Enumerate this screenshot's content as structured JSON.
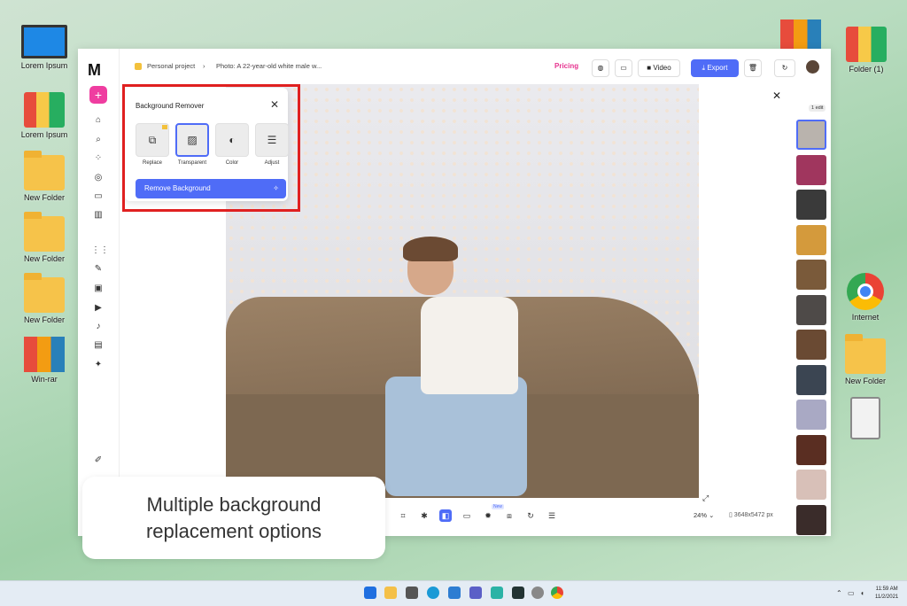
{
  "desktop": {
    "left_icons": [
      {
        "label": "Lorem Ipsum",
        "icon": "computer-icon"
      },
      {
        "label": "Lorem Ipsum",
        "icon": "binders-icon"
      },
      {
        "label": "New Folder",
        "icon": "folder-icon"
      },
      {
        "label": "New Folder",
        "icon": "folder-icon"
      },
      {
        "label": "New Folder",
        "icon": "folder-icon"
      },
      {
        "label": "Win-rar",
        "icon": "winrar-icon"
      }
    ],
    "right_icons": [
      {
        "label": "Folder (1)",
        "icon": "binders-icon"
      },
      {
        "label": "Internet",
        "icon": "chrome-icon"
      },
      {
        "label": "New Folder",
        "icon": "folder-icon"
      },
      {
        "label": "",
        "icon": "trash-icon"
      }
    ]
  },
  "app": {
    "topbar": {
      "project": "Personal project",
      "photo_title": "Photo: A 22-year-old white male w...",
      "pricing": "Pricing",
      "video_label": "Video",
      "export_label": "Export"
    },
    "bg_remover": {
      "title": "Background Remover",
      "options": [
        {
          "label": "Replace",
          "icon": "replace-icon",
          "selected": false
        },
        {
          "label": "Transparent",
          "icon": "transparent-icon",
          "selected": true
        },
        {
          "label": "Color",
          "icon": "palette-icon",
          "selected": false
        },
        {
          "label": "Adjust",
          "icon": "sliders-icon",
          "selected": false
        }
      ],
      "remove_button": "Remove Background"
    },
    "history": {
      "edit_chip": "1 edit"
    },
    "bottom": {
      "new_badge": "New",
      "zoom": "24%",
      "dimensions": "3648x5472 px"
    }
  },
  "caption": {
    "line1": "Multiple background",
    "line2": "replacement options"
  },
  "taskbar": {
    "time": "11:59 AM",
    "date": "11/2/2021"
  },
  "colors": {
    "accent": "#4f6cf7",
    "pink": "#ef3da0",
    "highlight": "#e02020"
  }
}
